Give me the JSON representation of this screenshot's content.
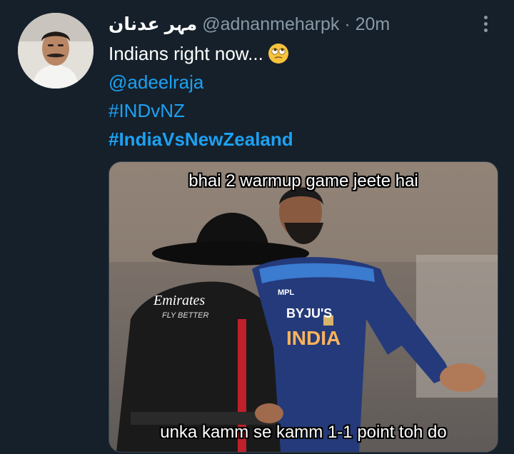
{
  "tweet": {
    "display_name": "مہر عدنان",
    "handle": "@adnanmeharpk",
    "separator": "·",
    "time": "20m",
    "text": "Indians right now...",
    "emoji": "face-with-rolling-eyes",
    "mention": "@adeelraja",
    "hashtags": [
      "#INDvNZ",
      "#IndiaVsNewZealand"
    ]
  },
  "media": {
    "caption_top": "bhai 2 warmup game jeete hai",
    "caption_bottom": "unka kamm se kamm 1-1 point toh do",
    "sponsor_umpire": "Emirates",
    "sponsor_umpire_sub": "FLY BETTER",
    "sponsor_jersey": "BYJU'S",
    "jersey_text": "INDIA",
    "jersey_brand": "MPL"
  },
  "colors": {
    "background": "#15202b",
    "link": "#1da1f2",
    "muted": "#8899a6"
  }
}
